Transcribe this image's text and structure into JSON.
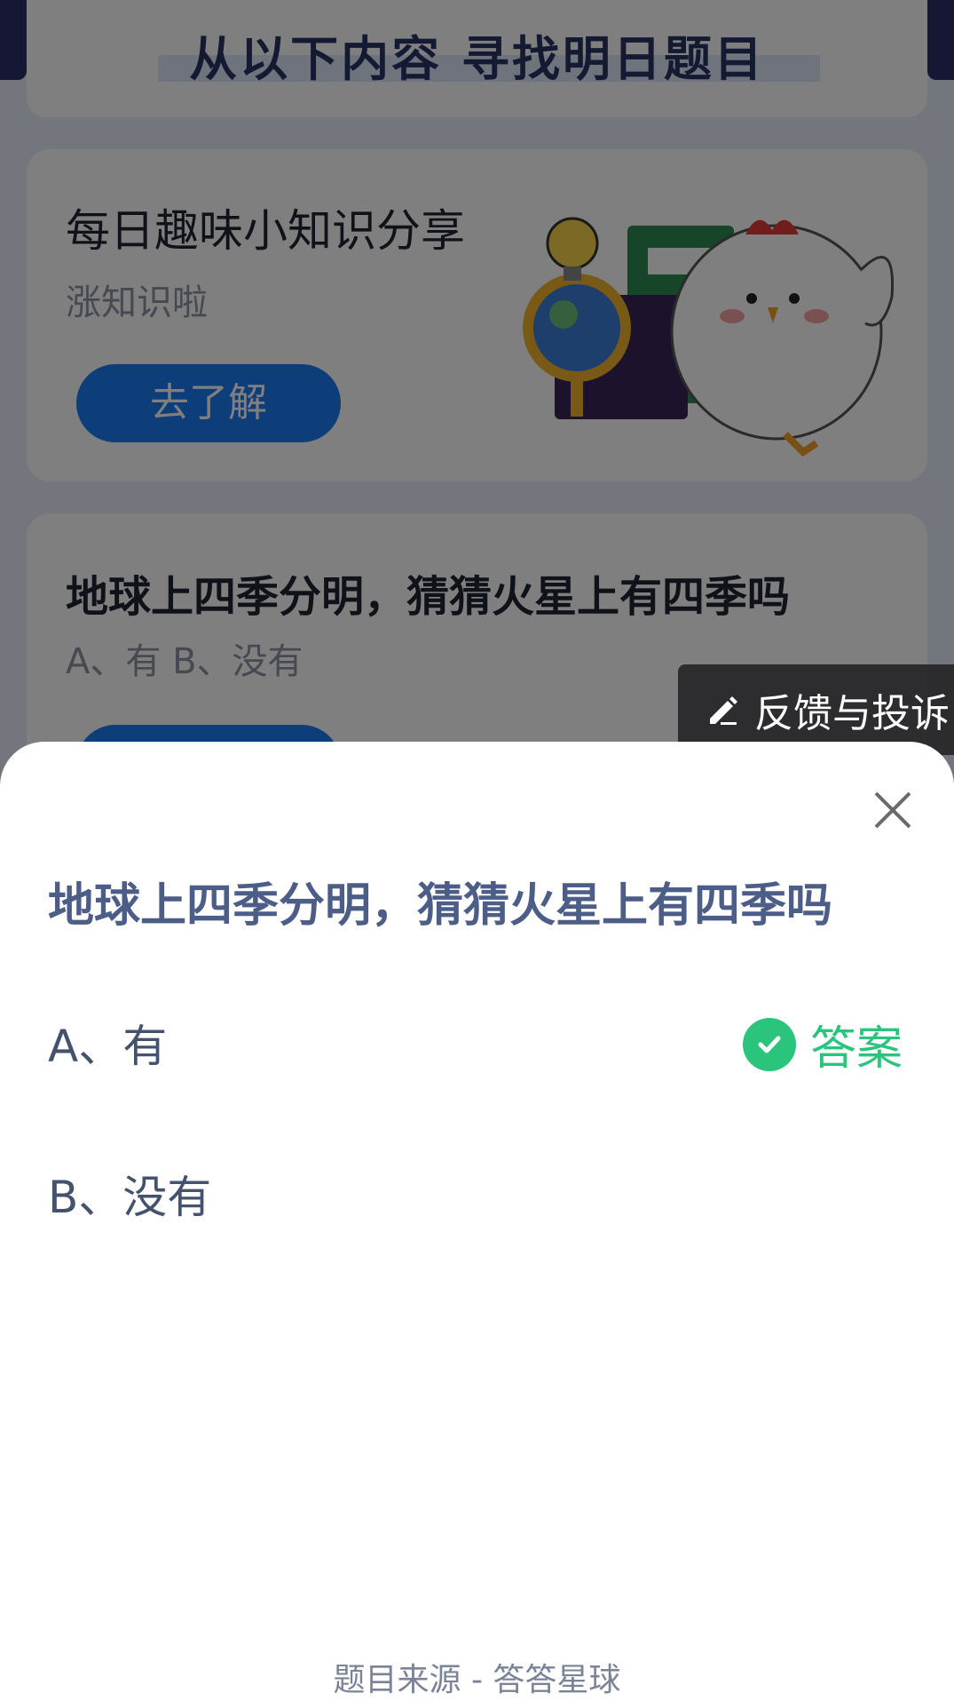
{
  "background": {
    "section_title": "从以下内容 寻找明日题目",
    "card1": {
      "title": "每日趣味小知识分享",
      "subtitle": "涨知识啦",
      "button": "去了解"
    },
    "card2": {
      "title": "地球上四季分明，猜猜火星上有四季吗",
      "options_line": "A、有    B、没有"
    }
  },
  "feedback": {
    "label": "反馈与投诉",
    "icon": "pen-icon"
  },
  "sheet": {
    "question": "地球上四季分明，猜猜火星上有四季吗",
    "options": [
      {
        "label": "A、有",
        "is_answer": true
      },
      {
        "label": "B、没有",
        "is_answer": false
      }
    ],
    "answer_label": "答案",
    "source": "题目来源 - 答答星球",
    "close_icon": "close-icon",
    "check_icon": "check-circle-icon"
  },
  "colors": {
    "accent_blue": "#1b7df5",
    "answer_green": "#2bc47d",
    "question_text": "#4c5d87",
    "header_navy": "#2a2f6b"
  }
}
